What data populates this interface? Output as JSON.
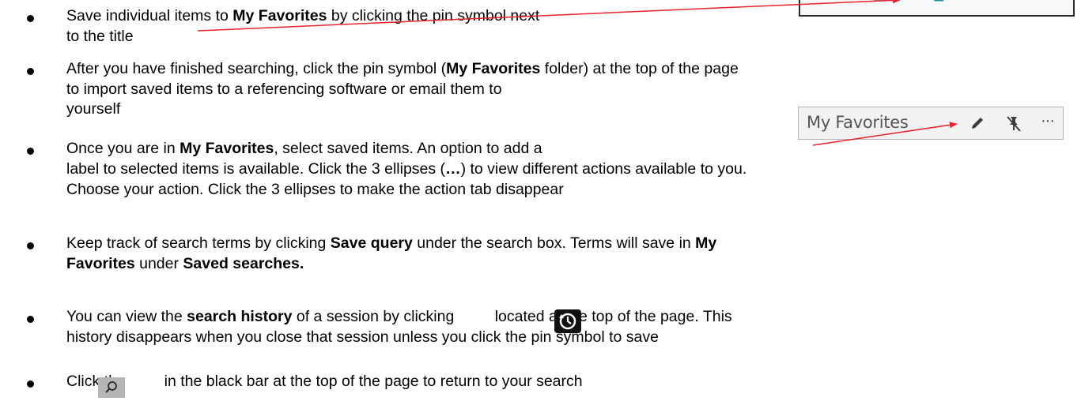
{
  "bullets": [
    {
      "lines": [
        [
          {
            "text": "Save individual items to ",
            "bold": false
          },
          {
            "text": "My Favorites",
            "bold": true
          },
          {
            "text": " by clicking the pin symbol next",
            "bold": false
          }
        ],
        [
          {
            "text": "to the title",
            "bold": false
          }
        ]
      ]
    },
    {
      "lines": [
        [
          {
            "text": "After you have finished searching, click the pin symbol (",
            "bold": false
          },
          {
            "text": "My Favorites",
            "bold": true
          },
          {
            "text": " folder) at the top of the page",
            "bold": false
          }
        ],
        [
          {
            "text": "to import saved items to a referencing software or email them to",
            "bold": false
          }
        ],
        [
          {
            "text": "yourself",
            "bold": false
          }
        ]
      ]
    },
    {
      "lines": [
        [
          {
            "text": "Once you are in ",
            "bold": false
          },
          {
            "text": "My Favorites",
            "bold": true
          },
          {
            "text": ", select saved items. An option to add a",
            "bold": false
          }
        ],
        [
          {
            "text": "label to selected items is available. Click the 3 ellipses (",
            "bold": false
          },
          {
            "text": "…",
            "bold": true
          },
          {
            "text": ") to view different actions available to you.",
            "bold": false
          }
        ],
        [
          {
            "text": "Choose your action. Click the 3 ellipses to make the action tab disappear",
            "bold": false
          }
        ]
      ]
    },
    {
      "lines": [
        [
          {
            "text": "Keep track of search terms by clicking ",
            "bold": false
          },
          {
            "text": "Save query",
            "bold": true
          },
          {
            "text": " under the search box. Terms will save in ",
            "bold": false
          },
          {
            "text": "My",
            "bold": true
          }
        ],
        [
          {
            "text": "Favorites",
            "bold": true
          },
          {
            "text": " under ",
            "bold": false
          },
          {
            "text": "Saved searches.",
            "bold": true
          }
        ]
      ]
    },
    {
      "lines": [
        [
          {
            "text": "You can view the ",
            "bold": false
          },
          {
            "text": "search history",
            "bold": true
          },
          {
            "text": " of a session by clicking ",
            "bold": false
          },
          {
            "text": "",
            "bold": false,
            "spacer": 46
          },
          {
            "text": "located at the top of the page. This",
            "bold": false
          }
        ],
        [
          {
            "text": "history disappears when you close that session unless you click the pin symbol to save",
            "bold": false
          }
        ]
      ]
    },
    {
      "lines": [
        [
          {
            "text": "Click the ",
            "bold": false
          },
          {
            "text": "",
            "bold": false,
            "spacer": 38
          },
          {
            "text": " in the black bar at the top of the page to return to your search",
            "bold": false
          }
        ]
      ]
    }
  ],
  "favorites_toolbar": {
    "label": "My Favorites",
    "edit_icon": "pencil-icon",
    "unpin_icon": "unpin-icon",
    "more_icon": "more-actions-icon",
    "more_glyph": "···"
  },
  "icons": {
    "history": "search-history-icon",
    "search": "search-icon"
  },
  "colors": {
    "arrow": "#e8232a",
    "history_icon_bg": "#111111",
    "search_icon_bg": "#b5b5b5",
    "text": "#000000"
  }
}
